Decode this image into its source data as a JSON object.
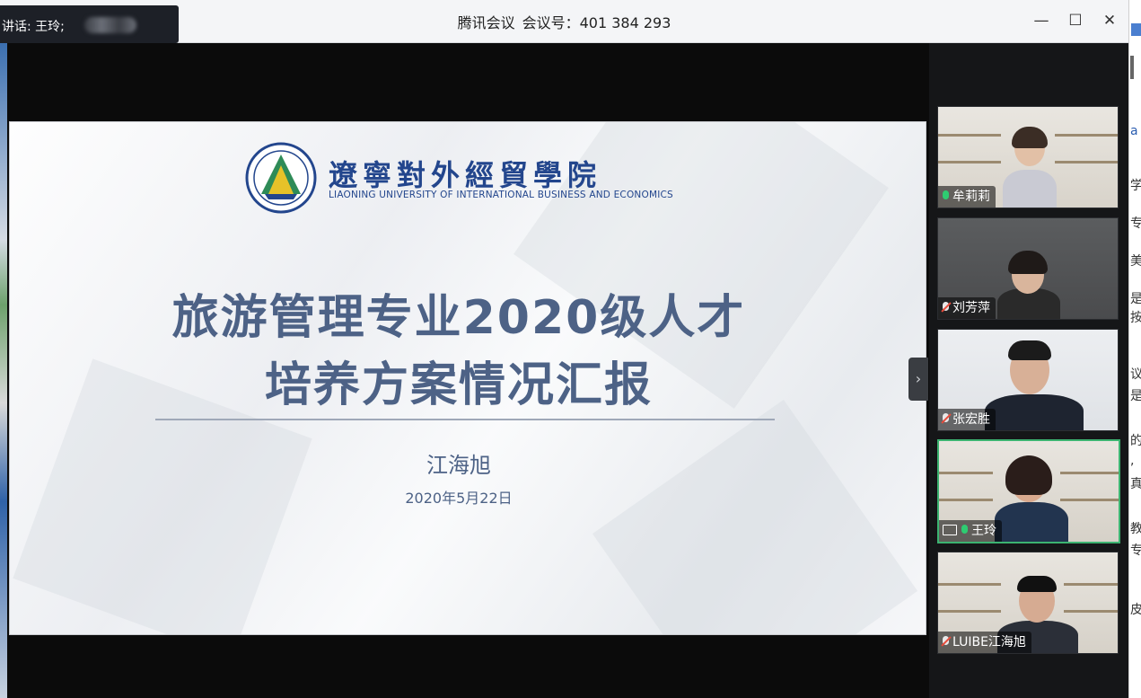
{
  "window": {
    "app_name": "腾讯会议",
    "meeting_label": "会议号：",
    "meeting_id": "401 384 293",
    "minimize": "—",
    "maximize": "☐",
    "close": "✕"
  },
  "speaking": {
    "text": "讲话: 王玲;"
  },
  "slide": {
    "university_cn": "遼寧對外經貿學院",
    "university_en": "LIAONING UNIVERSITY OF INTERNATIONAL BUSINESS AND ECONOMICS",
    "title_line1": "旅游管理专业2020级人才",
    "title_line2": "培养方案情况汇报",
    "presenter": "江海旭",
    "date": "2020年5月22日"
  },
  "participants": [
    {
      "name": "牟莉莉",
      "mic": "on"
    },
    {
      "name": "刘芳萍",
      "mic": "off"
    },
    {
      "name": "张宏胜",
      "mic": "off"
    },
    {
      "name": "王玲",
      "mic": "on",
      "sharing": true
    },
    {
      "name": "LUIBE江海旭",
      "mic": "off"
    }
  ],
  "colors": {
    "slide_title": "#4d6286",
    "university_blue": "#23468d",
    "active_border": "#3cb371"
  }
}
